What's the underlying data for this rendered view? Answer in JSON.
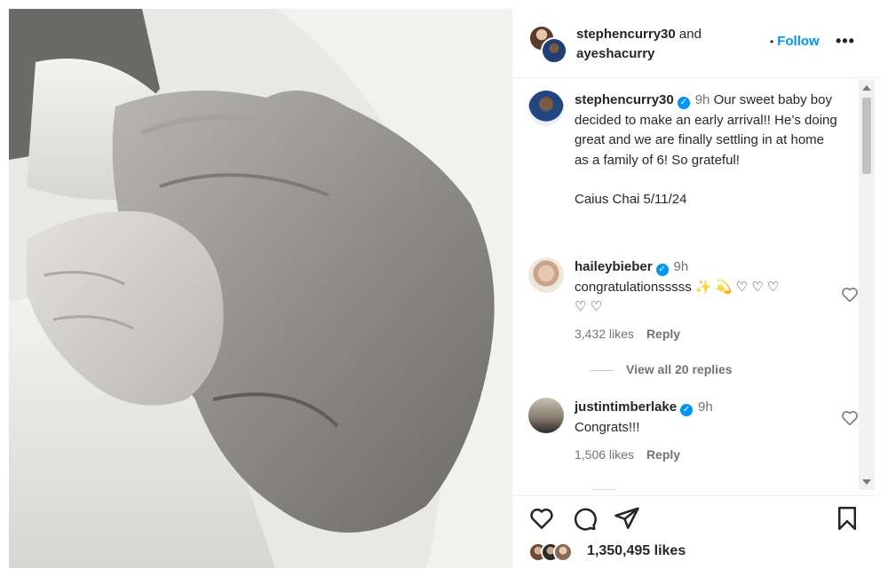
{
  "post_image": {
    "alt_subject": "photo"
  },
  "header": {
    "user1": "stephencurry30",
    "joiner": "and",
    "user2": "ayeshacurry",
    "follow_label": "Follow",
    "more_icon": "more-horizontal-icon"
  },
  "caption": {
    "username": "stephencurry30",
    "verified": true,
    "time": "9h",
    "text": "Our sweet baby boy decided to make an early arrival!! He’s doing great and we are finally settling in at home as a family of 6! So grateful!",
    "signoff": "Caius Chai 5/11/24"
  },
  "comments": [
    {
      "username": "haileybieber",
      "verified": true,
      "time": "9h",
      "text": "congratulationsssss",
      "emojis": "✨ 💫 ♡ ♡ ♡",
      "emojis_line2": "♡ ♡",
      "likes": "3,432 likes",
      "reply_label": "Reply",
      "view_replies": "View all 20 replies"
    },
    {
      "username": "justintimberlake",
      "verified": true,
      "time": "9h",
      "text": "Congrats!!!",
      "likes": "1,506 likes",
      "reply_label": "Reply"
    }
  ],
  "actions": {
    "icons": [
      "heart-icon",
      "comment-icon",
      "share-icon",
      "bookmark-icon"
    ],
    "likes": "1,350,495 likes"
  },
  "colors": {
    "accent": "#0095f6",
    "text": "#262626",
    "muted": "#737373"
  }
}
